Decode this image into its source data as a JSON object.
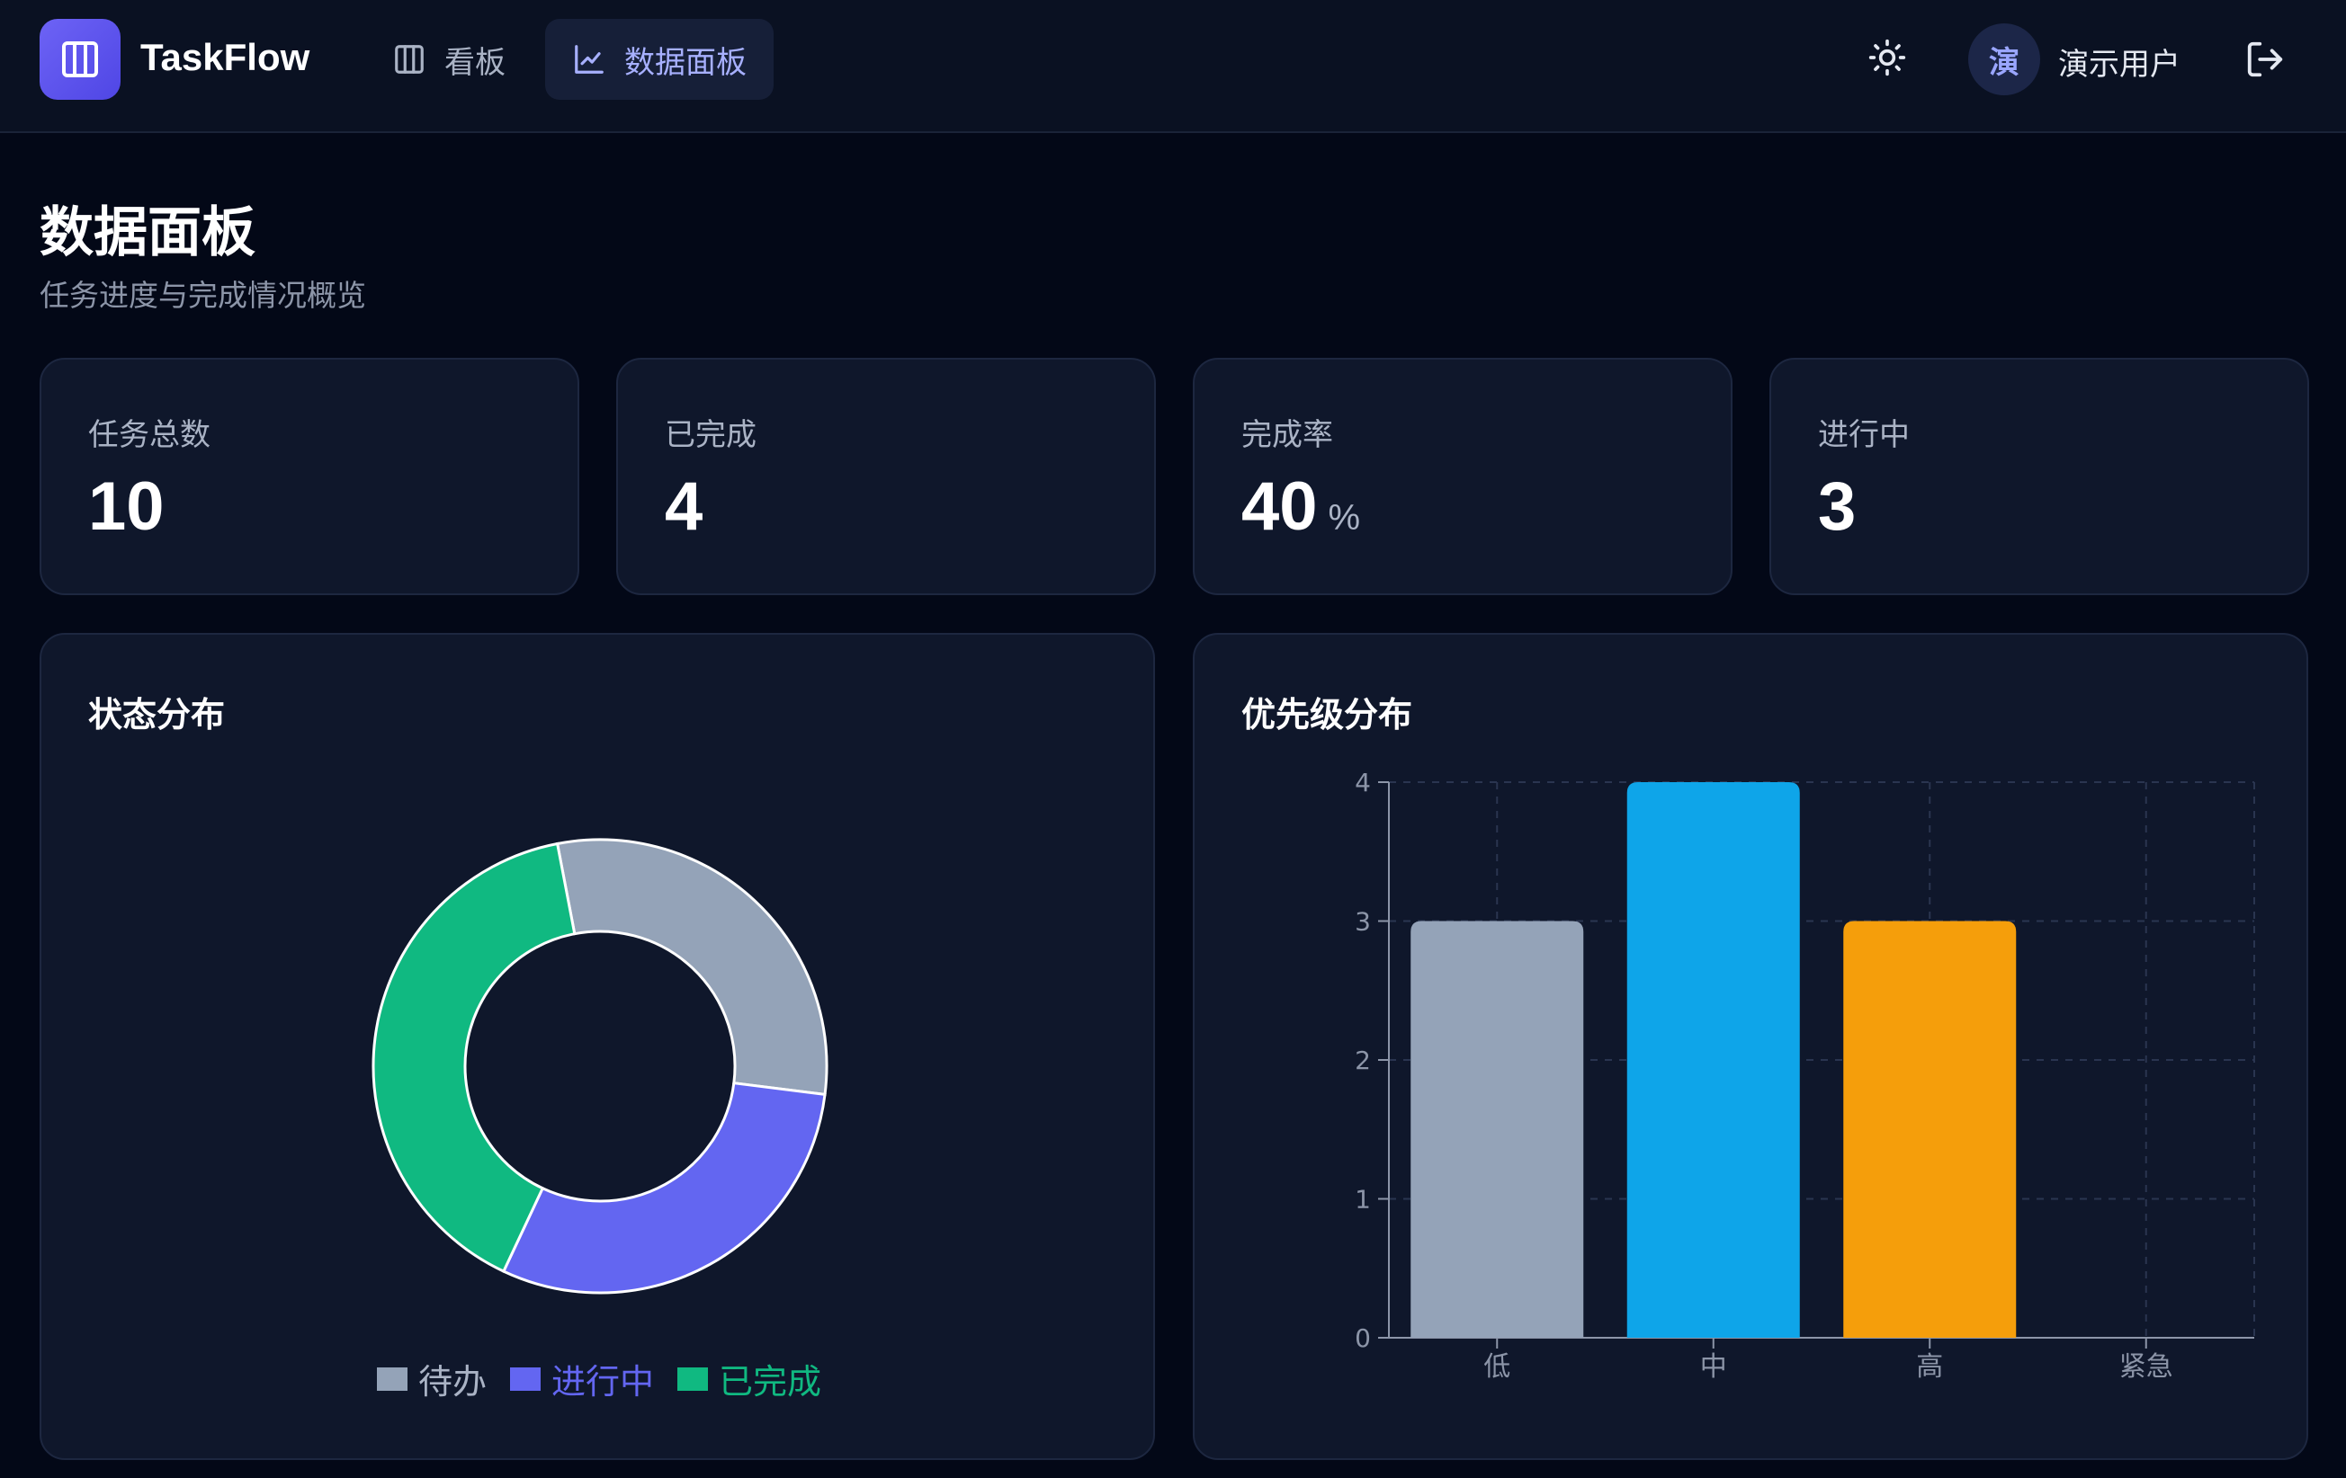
{
  "app": {
    "brand": "TaskFlow",
    "nav": [
      {
        "label": "看板",
        "icon": "columns-icon",
        "active": false
      },
      {
        "label": "数据面板",
        "icon": "line-chart-icon",
        "active": true
      }
    ],
    "user": {
      "avatar_initial": "演",
      "name": "演示用户"
    },
    "accent": "#6366f1"
  },
  "page": {
    "title": "数据面板",
    "subtitle": "任务进度与完成情况概览"
  },
  "stats": [
    {
      "label": "任务总数",
      "value": "10",
      "unit": ""
    },
    {
      "label": "已完成",
      "value": "4",
      "unit": ""
    },
    {
      "label": "完成率",
      "value": "40",
      "unit": "%"
    },
    {
      "label": "进行中",
      "value": "3",
      "unit": ""
    }
  ],
  "chart_data": [
    {
      "type": "pie",
      "title": "状态分布",
      "donut": true,
      "categories": [
        "待办",
        "进行中",
        "已完成"
      ],
      "values": [
        3,
        3,
        4
      ],
      "colors": [
        "#94a3b8",
        "#6366f1",
        "#10b981"
      ],
      "legend": "bottom"
    },
    {
      "type": "bar",
      "title": "优先级分布",
      "categories": [
        "低",
        "中",
        "高",
        "紧急"
      ],
      "values": [
        3,
        4,
        3,
        0
      ],
      "colors": [
        "#94a3b8",
        "#0ea5e9",
        "#f59e0b",
        "#ef4444"
      ],
      "ylim": [
        0,
        4
      ],
      "yticks": [
        "0",
        "1",
        "2",
        "3",
        "4"
      ],
      "grid": true
    }
  ]
}
